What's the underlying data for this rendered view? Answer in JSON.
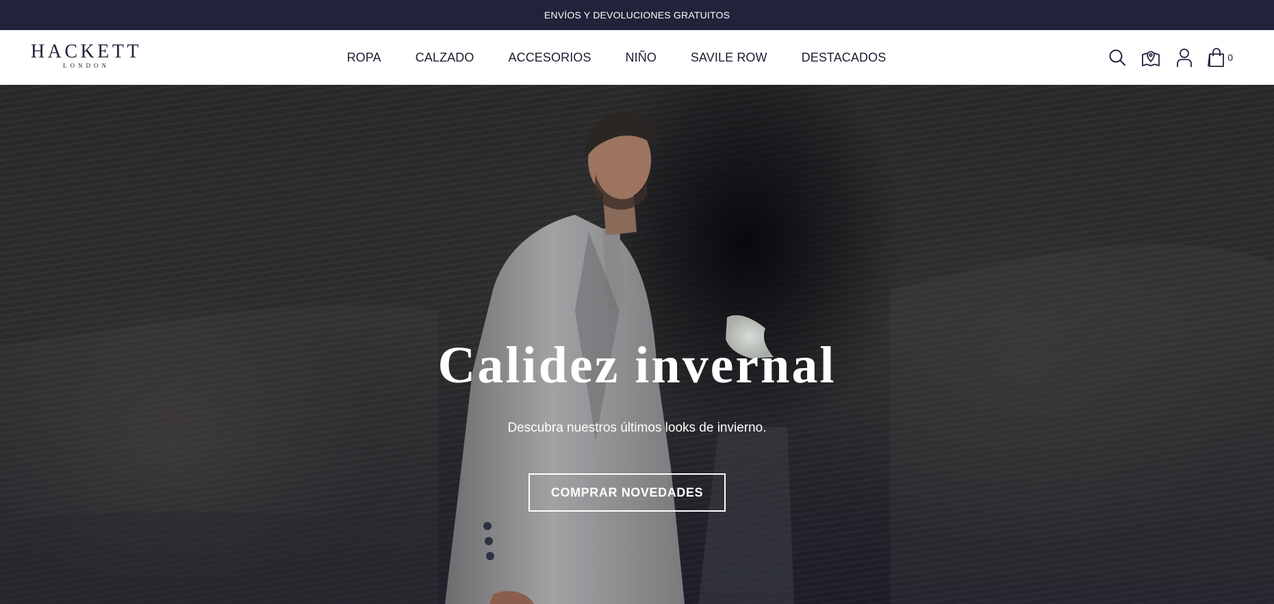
{
  "announcement": {
    "text": "ENVÍOS Y DEVOLUCIONES GRATUITOS"
  },
  "header": {
    "logo": {
      "main": "HACKETT",
      "sub": "LONDON"
    },
    "nav": [
      {
        "label": "ROPA"
      },
      {
        "label": "CALZADO"
      },
      {
        "label": "ACCESORIOS"
      },
      {
        "label": "NIÑO"
      },
      {
        "label": "SAVILE ROW"
      },
      {
        "label": "DESTACADOS"
      }
    ],
    "icons": [
      "search-icon",
      "store-locator-icon",
      "account-icon",
      "bag-icon"
    ],
    "cart_count": "0"
  },
  "hero": {
    "title": "Calidez invernal",
    "subtitle": "Descubra nuestros últimos looks de invierno.",
    "cta_label": "COMPRAR NOVEDADES"
  },
  "colors": {
    "announcement_bg": "#20233a",
    "brand_navy": "#20233a",
    "header_bg": "#ffffff",
    "hero_text": "#ffffff"
  }
}
